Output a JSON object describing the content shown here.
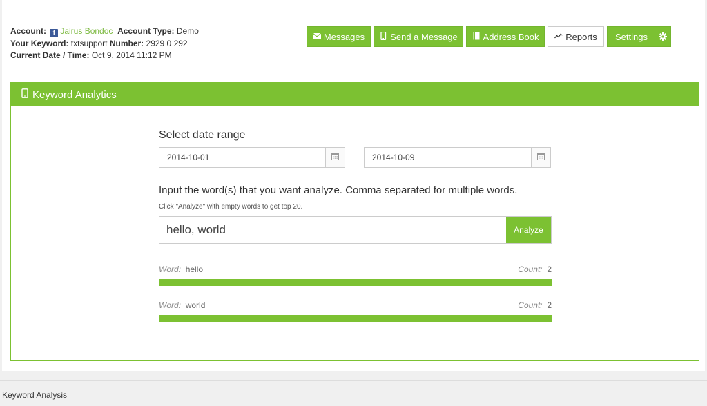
{
  "account": {
    "account_label": "Account:",
    "account_name": "Jairus Bondoc",
    "type_label": "Account Type:",
    "type_value": "Demo",
    "keyword_label": "Your Keyword:",
    "keyword_value": "txtsupport",
    "number_label": "Number:",
    "number_value": "2929 0 292",
    "date_label": "Current Date / Time:",
    "date_value": "Oct 9, 2014 11:12 PM"
  },
  "nav": {
    "messages": "Messages",
    "send_message": "Send a Message",
    "address_book": "Address Book",
    "reports": "Reports",
    "settings": "Settings"
  },
  "panel": {
    "title": "Keyword Analytics"
  },
  "date_range": {
    "label": "Select date range",
    "start": "2014-10-01",
    "end": "2014-10-09"
  },
  "words": {
    "label": "Input the word(s) that you want analyze. Comma separated for multiple words.",
    "hint": "Click \"Analyze\" with empty words to get top 20.",
    "value": "hello, world",
    "analyze_label": "Analyze"
  },
  "results": [
    {
      "word_label": "Word:",
      "word": "hello",
      "count_label": "Count:",
      "count": "2",
      "fill": 1.0
    },
    {
      "word_label": "Word:",
      "word": "world",
      "count_label": "Count:",
      "count": "2",
      "fill": 1.0
    }
  ],
  "footer": {
    "title": "Keyword Analysis"
  },
  "colors": {
    "accent": "#7cc132",
    "facebook": "#3b5998"
  }
}
